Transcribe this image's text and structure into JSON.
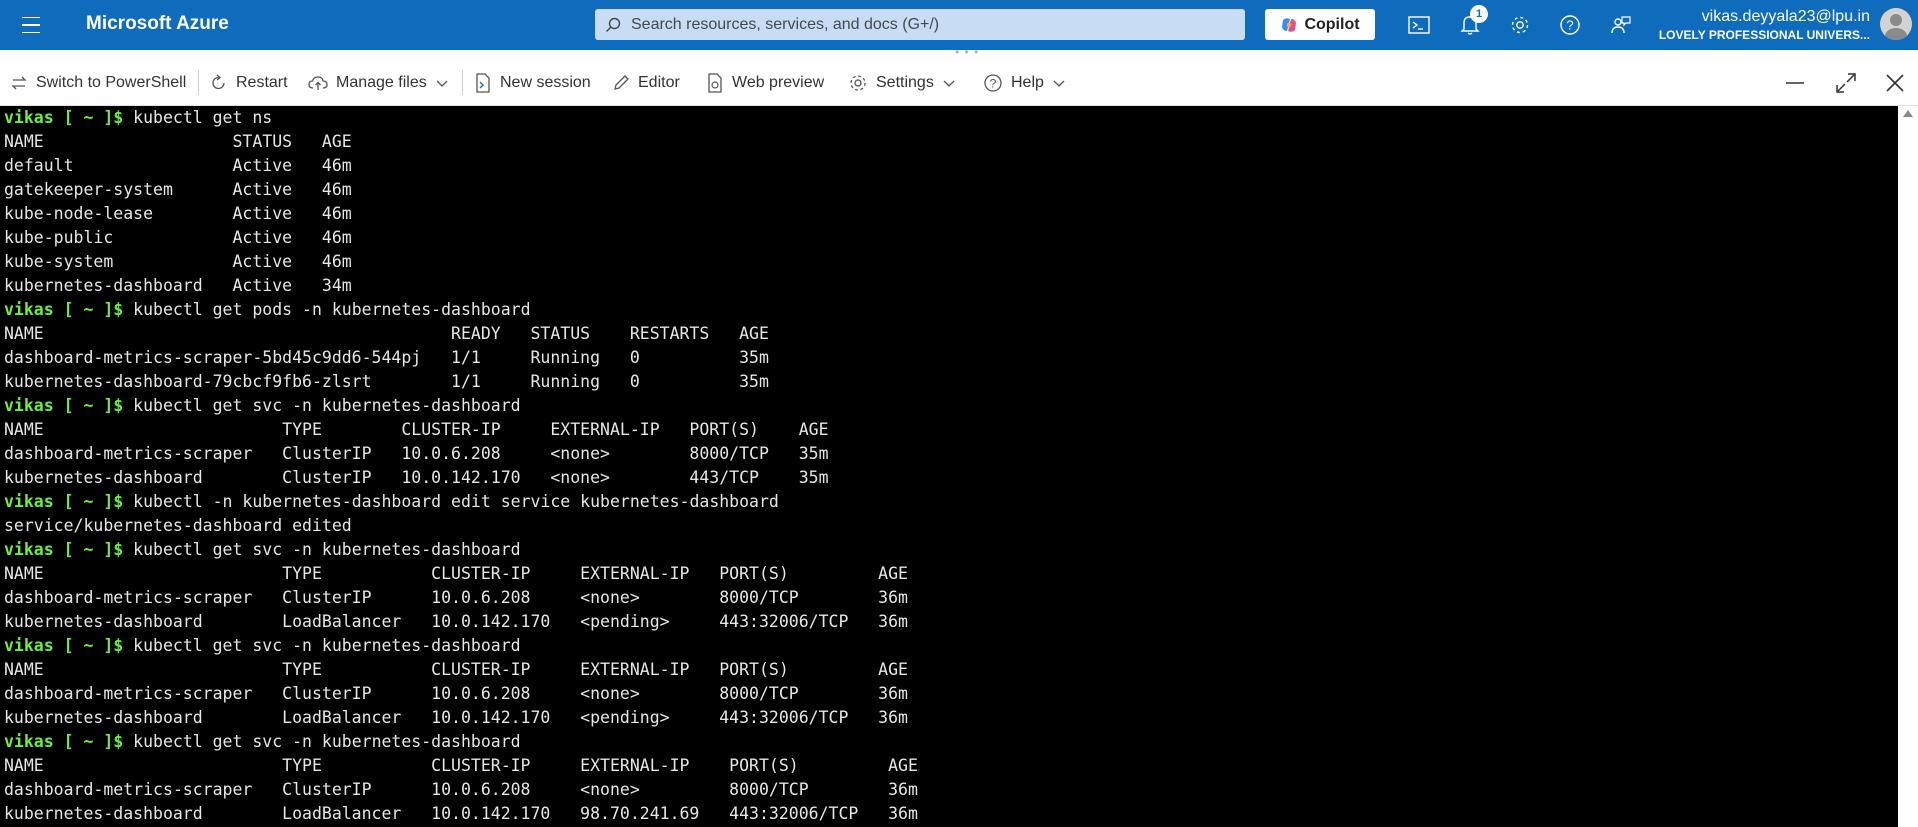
{
  "header": {
    "brand": "Microsoft Azure",
    "search_placeholder": "Search resources, services, and docs (G+/)",
    "copilot_label": "Copilot",
    "notification_count": "1",
    "user_email": "vikas.deyyala23@lpu.in",
    "user_org": "LOVELY PROFESSIONAL UNIVERS..."
  },
  "toolbar": {
    "switch_label": "Switch to PowerShell",
    "restart_label": "Restart",
    "manage_files_label": "Manage files",
    "new_session_label": "New session",
    "editor_label": "Editor",
    "web_preview_label": "Web preview",
    "settings_label": "Settings",
    "help_label": "Help"
  },
  "terminal": {
    "prompt": "vikas [ ~ ]$",
    "lines": [
      {
        "type": "cmd",
        "text": " kubectl get ns"
      },
      {
        "type": "out",
        "text": "NAME                   STATUS   AGE"
      },
      {
        "type": "out",
        "text": "default                Active   46m"
      },
      {
        "type": "out",
        "text": "gatekeeper-system      Active   46m"
      },
      {
        "type": "out",
        "text": "kube-node-lease        Active   46m"
      },
      {
        "type": "out",
        "text": "kube-public            Active   46m"
      },
      {
        "type": "out",
        "text": "kube-system            Active   46m"
      },
      {
        "type": "out",
        "text": "kubernetes-dashboard   Active   34m"
      },
      {
        "type": "cmd",
        "text": " kubectl get pods -n kubernetes-dashboard"
      },
      {
        "type": "out",
        "text": "NAME                                         READY   STATUS    RESTARTS   AGE"
      },
      {
        "type": "out",
        "text": "dashboard-metrics-scraper-5bd45c9dd6-544pj   1/1     Running   0          35m"
      },
      {
        "type": "out",
        "text": "kubernetes-dashboard-79cbcf9fb6-zlsrt        1/1     Running   0          35m"
      },
      {
        "type": "cmd",
        "text": " kubectl get svc -n kubernetes-dashboard"
      },
      {
        "type": "out",
        "text": "NAME                        TYPE        CLUSTER-IP     EXTERNAL-IP   PORT(S)    AGE"
      },
      {
        "type": "out",
        "text": "dashboard-metrics-scraper   ClusterIP   10.0.6.208     <none>        8000/TCP   35m"
      },
      {
        "type": "out",
        "text": "kubernetes-dashboard        ClusterIP   10.0.142.170   <none>        443/TCP    35m"
      },
      {
        "type": "cmd",
        "text": " kubectl -n kubernetes-dashboard edit service kubernetes-dashboard"
      },
      {
        "type": "out",
        "text": "service/kubernetes-dashboard edited"
      },
      {
        "type": "cmd",
        "text": " kubectl get svc -n kubernetes-dashboard"
      },
      {
        "type": "out",
        "text": "NAME                        TYPE           CLUSTER-IP     EXTERNAL-IP   PORT(S)         AGE"
      },
      {
        "type": "out",
        "text": "dashboard-metrics-scraper   ClusterIP      10.0.6.208     <none>        8000/TCP        36m"
      },
      {
        "type": "out",
        "text": "kubernetes-dashboard        LoadBalancer   10.0.142.170   <pending>     443:32006/TCP   36m"
      },
      {
        "type": "cmd",
        "text": " kubectl get svc -n kubernetes-dashboard"
      },
      {
        "type": "out",
        "text": "NAME                        TYPE           CLUSTER-IP     EXTERNAL-IP   PORT(S)         AGE"
      },
      {
        "type": "out",
        "text": "dashboard-metrics-scraper   ClusterIP      10.0.6.208     <none>        8000/TCP        36m"
      },
      {
        "type": "out",
        "text": "kubernetes-dashboard        LoadBalancer   10.0.142.170   <pending>     443:32006/TCP   36m"
      },
      {
        "type": "cmd",
        "text": " kubectl get svc -n kubernetes-dashboard"
      },
      {
        "type": "out",
        "text": "NAME                        TYPE           CLUSTER-IP     EXTERNAL-IP    PORT(S)         AGE"
      },
      {
        "type": "out",
        "text": "dashboard-metrics-scraper   ClusterIP      10.0.6.208     <none>         8000/TCP        36m"
      },
      {
        "type": "out",
        "text": "kubernetes-dashboard        LoadBalancer   10.0.142.170   98.70.241.69   443:32006/TCP   36m"
      }
    ]
  }
}
